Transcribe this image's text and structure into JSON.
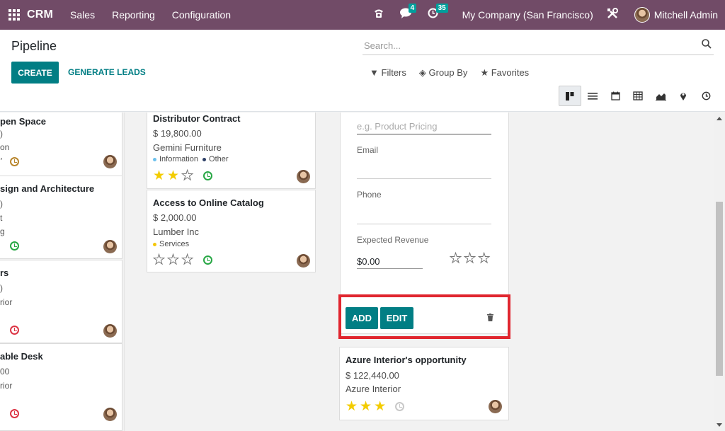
{
  "navbar": {
    "app_name": "CRM",
    "menu": [
      "Sales",
      "Reporting",
      "Configuration"
    ],
    "messages_count": "4",
    "activities_count": "35",
    "company": "My Company (San Francisco)",
    "user": "Mitchell Admin"
  },
  "control": {
    "title": "Pipeline",
    "create_label": "CREATE",
    "generate_label": "GENERATE LEADS",
    "search_placeholder": "Search...",
    "filters_label": "Filters",
    "groupby_label": "Group By",
    "favorites_label": "Favorites",
    "views": [
      "kanban-icon",
      "list-icon",
      "calendar-icon",
      "pivot-icon",
      "graph-icon",
      "map-icon",
      "activity-icon"
    ]
  },
  "column1": [
    {
      "title": "pen Space",
      "line2": ")",
      "line3": "on",
      "clock_color": "#b8862d"
    },
    {
      "title": "sign and Architecture",
      "line2": ")",
      "line3": "t",
      "line4": "g",
      "clock_color": "#28a745"
    },
    {
      "title": "rs",
      "line2": ")",
      "line3": "rior",
      "clock_color": "#dc3545"
    },
    {
      "title": "able Desk",
      "line2": "00",
      "line3": "rior",
      "clock_color": "#dc3545"
    }
  ],
  "column2": [
    {
      "title": "Distributor Contract",
      "amount": "$ 19,800.00",
      "customer": "Gemini Furniture",
      "tags": [
        {
          "label": "Information",
          "color": "#6cc1ed"
        },
        {
          "label": "Other",
          "color": "#2c3e65"
        }
      ],
      "stars": 2
    },
    {
      "title": "Access to Online Catalog",
      "amount": "$ 2,000.00",
      "customer": "Lumber Inc",
      "tags": [
        {
          "label": "Services",
          "color": "#f4c609"
        }
      ],
      "stars": 0
    }
  ],
  "quick_create": {
    "name_placeholder": "e.g. Product Pricing",
    "email_label": "Email",
    "phone_label": "Phone",
    "revenue_label": "Expected Revenue",
    "revenue_value": "$0.00",
    "add_label": "ADD",
    "edit_label": "EDIT"
  },
  "column3_card": {
    "title": "Azure Interior's opportunity",
    "amount": "$ 122,440.00",
    "customer": "Azure Interior",
    "stars": 3
  },
  "colors": {
    "brand": "#714b67",
    "primary": "#017e84",
    "highlight": "#e0262f",
    "star": "#f3cc00"
  }
}
